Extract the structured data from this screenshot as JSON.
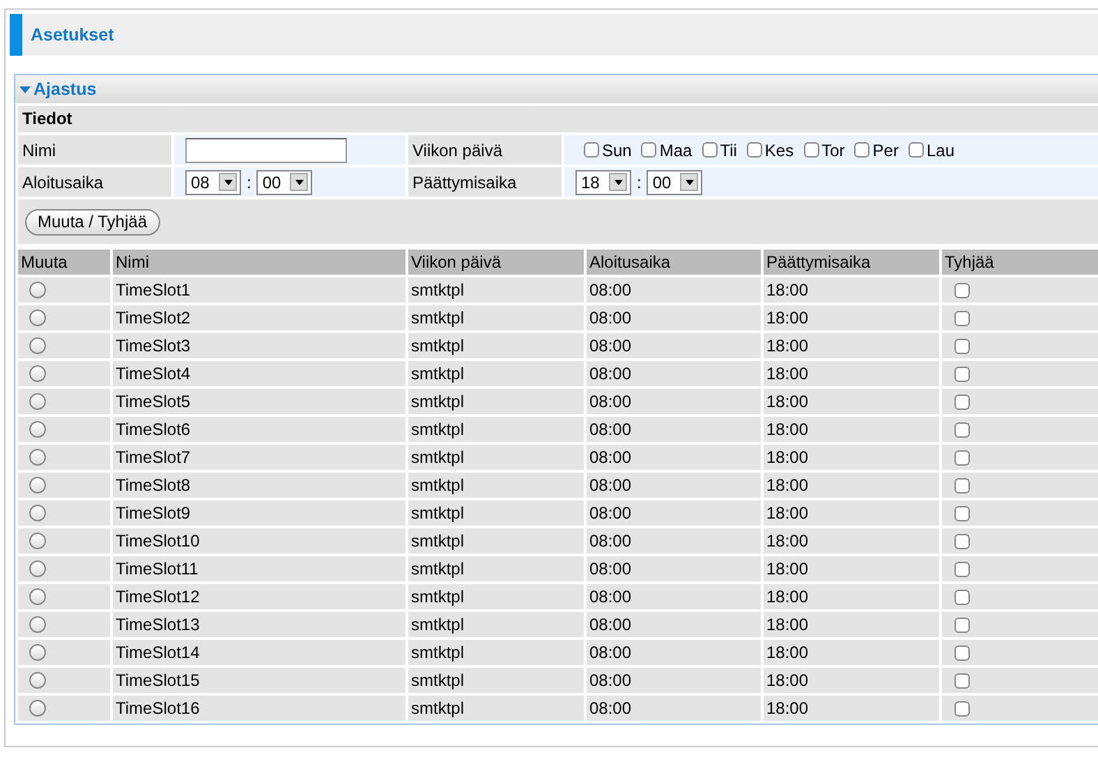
{
  "page_title": "Asetukset",
  "section": {
    "title": "Ajastus",
    "expanded": true
  },
  "form": {
    "title": "Tiedot",
    "name_label": "Nimi",
    "days_label": "Viikon päivä",
    "days": [
      {
        "label": "Sun",
        "checked": false
      },
      {
        "label": "Maa",
        "checked": false
      },
      {
        "label": "Tii",
        "checked": false
      },
      {
        "label": "Kes",
        "checked": false
      },
      {
        "label": "Tor",
        "checked": false
      },
      {
        "label": "Per",
        "checked": false
      },
      {
        "label": "Lau",
        "checked": false
      }
    ],
    "start_label": "Aloitusaika",
    "start_hour": "08",
    "start_minute": "00",
    "end_label": "Päättymisaika",
    "end_hour": "18",
    "end_minute": "00",
    "separator": ":",
    "button": "Muuta / Tyhjää"
  },
  "table": {
    "columns": [
      "Muuta",
      "Nimi",
      "Viikon päivä",
      "Aloitusaika",
      "Päättymisaika",
      "Tyhjää"
    ],
    "rows": [
      {
        "selected": false,
        "name": "TimeSlot1",
        "days": "smtktpl",
        "start": "08:00",
        "end": "18:00",
        "clear": false
      },
      {
        "selected": false,
        "name": "TimeSlot2",
        "days": "smtktpl",
        "start": "08:00",
        "end": "18:00",
        "clear": false
      },
      {
        "selected": false,
        "name": "TimeSlot3",
        "days": "smtktpl",
        "start": "08:00",
        "end": "18:00",
        "clear": false
      },
      {
        "selected": false,
        "name": "TimeSlot4",
        "days": "smtktpl",
        "start": "08:00",
        "end": "18:00",
        "clear": false
      },
      {
        "selected": false,
        "name": "TimeSlot5",
        "days": "smtktpl",
        "start": "08:00",
        "end": "18:00",
        "clear": false
      },
      {
        "selected": false,
        "name": "TimeSlot6",
        "days": "smtktpl",
        "start": "08:00",
        "end": "18:00",
        "clear": false
      },
      {
        "selected": false,
        "name": "TimeSlot7",
        "days": "smtktpl",
        "start": "08:00",
        "end": "18:00",
        "clear": false
      },
      {
        "selected": false,
        "name": "TimeSlot8",
        "days": "smtktpl",
        "start": "08:00",
        "end": "18:00",
        "clear": false
      },
      {
        "selected": false,
        "name": "TimeSlot9",
        "days": "smtktpl",
        "start": "08:00",
        "end": "18:00",
        "clear": false
      },
      {
        "selected": false,
        "name": "TimeSlot10",
        "days": "smtktpl",
        "start": "08:00",
        "end": "18:00",
        "clear": false
      },
      {
        "selected": false,
        "name": "TimeSlot11",
        "days": "smtktpl",
        "start": "08:00",
        "end": "18:00",
        "clear": false
      },
      {
        "selected": false,
        "name": "TimeSlot12",
        "days": "smtktpl",
        "start": "08:00",
        "end": "18:00",
        "clear": false
      },
      {
        "selected": false,
        "name": "TimeSlot13",
        "days": "smtktpl",
        "start": "08:00",
        "end": "18:00",
        "clear": false
      },
      {
        "selected": false,
        "name": "TimeSlot14",
        "days": "smtktpl",
        "start": "08:00",
        "end": "18:00",
        "clear": false
      },
      {
        "selected": false,
        "name": "TimeSlot15",
        "days": "smtktpl",
        "start": "08:00",
        "end": "18:00",
        "clear": false
      },
      {
        "selected": false,
        "name": "TimeSlot16",
        "days": "smtktpl",
        "start": "08:00",
        "end": "18:00",
        "clear": false
      }
    ]
  }
}
